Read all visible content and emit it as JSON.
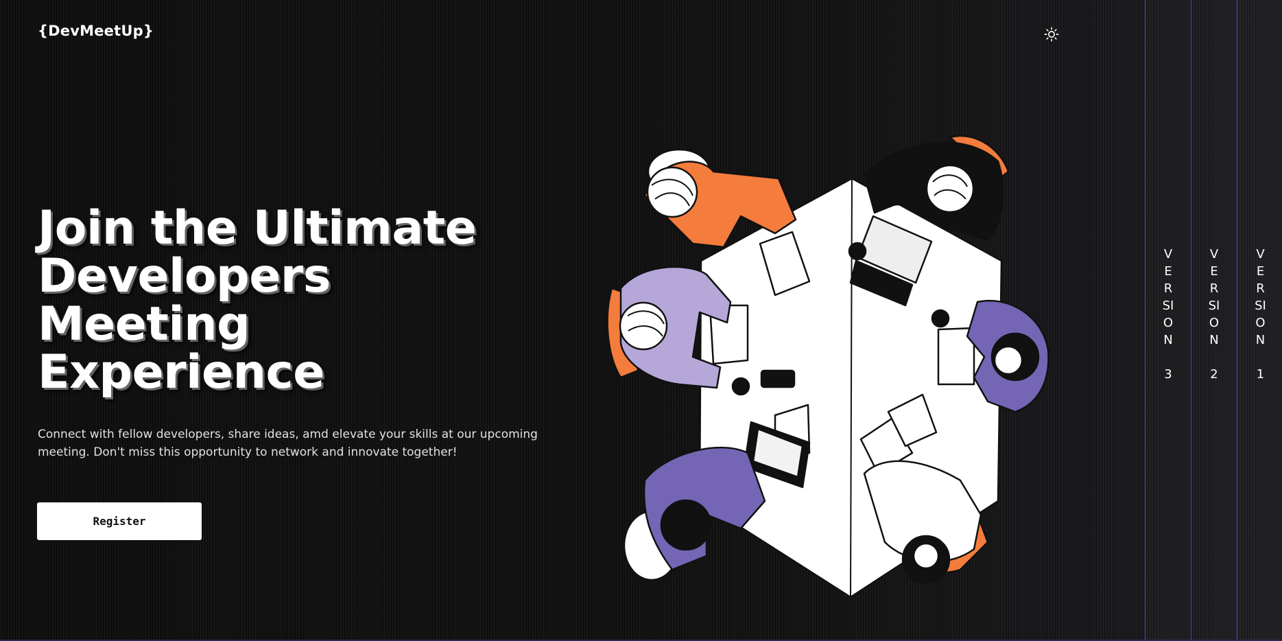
{
  "header": {
    "logo": "{DevMeetUp}",
    "theme_toggle_icon": "sun-icon"
  },
  "hero": {
    "title": "Join the Ultimate\nDevelopers\nMeeting\nExperience",
    "description": "Connect with fellow developers, share ideas, amd elevate your skills at our upcoming meeting. Don't miss this opportunity to network and innovate together!",
    "register_label": "Register"
  },
  "illustration": {
    "icon": "developers-meeting-illustration"
  },
  "versions": [
    {
      "label": "VERSION\n\n3"
    },
    {
      "label": "VERSION\n\n2"
    },
    {
      "label": "VERSION\n\n1"
    }
  ],
  "colors": {
    "background": "#0d0d0d",
    "accent_orange": "#f47c3c",
    "accent_purple": "#7466b4",
    "accent_lavender": "#b5a8d8",
    "version_border": "#4a46b8"
  }
}
